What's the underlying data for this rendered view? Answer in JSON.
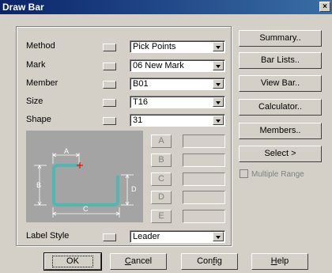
{
  "window": {
    "title": "Draw Bar",
    "close": "×"
  },
  "form": {
    "method": {
      "label": "Method",
      "value": "Pick Points"
    },
    "mark": {
      "label": "Mark",
      "value": "06 New Mark"
    },
    "member": {
      "label": "Member",
      "value": "B01"
    },
    "size": {
      "label": "Size",
      "value": "T16"
    },
    "shape": {
      "label": "Shape",
      "value": "31"
    },
    "label_style": {
      "label": "Label Style",
      "value": "Leader"
    }
  },
  "diagram": {
    "dim_a": "A",
    "dim_b": "B",
    "dim_c": "C",
    "dim_d": "D"
  },
  "dimensions": [
    {
      "letter": "A",
      "value": ""
    },
    {
      "letter": "B",
      "value": ""
    },
    {
      "letter": "C",
      "value": ""
    },
    {
      "letter": "D",
      "value": ""
    },
    {
      "letter": "E",
      "value": ""
    }
  ],
  "side_buttons": {
    "summary": "Summary..",
    "bar_lists": "Bar Lists..",
    "view_bar": "View Bar..",
    "calculator": "Calculator..",
    "members": "Members..",
    "select": "Select >"
  },
  "multiple_range": {
    "label": "Multiple Range",
    "checked": false
  },
  "bottom_buttons": {
    "ok": "OK",
    "cancel_first": "C",
    "cancel_rest": "ancel",
    "config_first": "Con",
    "config_u": "f",
    "config_rest": "ig",
    "help_first": "H",
    "help_rest": "elp"
  },
  "colors": {
    "bar": "#4fb8b0",
    "marker": "#ff0000",
    "diagram_bg": "#a4a4a4"
  }
}
